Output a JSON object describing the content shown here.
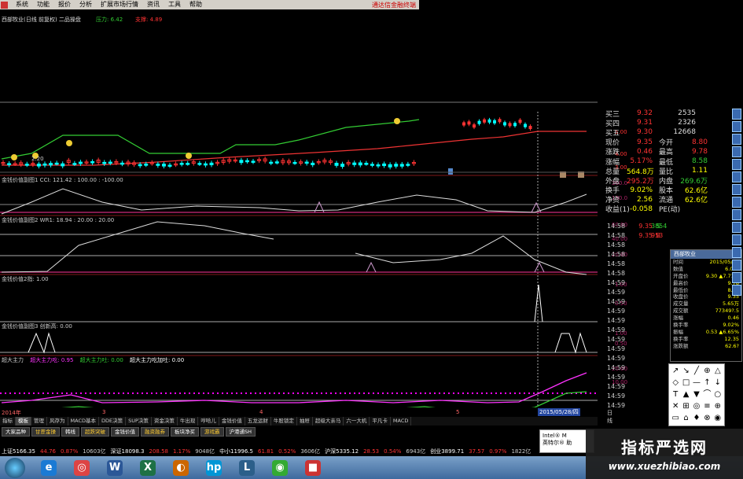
{
  "menu": [
    "系统",
    "功能",
    "报价",
    "分析",
    "扩展市场行情",
    "资讯",
    "工具",
    "帮助"
  ],
  "brand": "通达信金融终端",
  "chart_title": "西部牧业(日线 前复权) 二品操盘",
  "pressure": {
    "label": "压力:",
    "value": "6.42",
    "support_label": "支撑:",
    "support_value": "4.89"
  },
  "main_axis": [
    "5.00",
    "4.00",
    "3.00"
  ],
  "main_low_label": "2.20",
  "panels": [
    {
      "title": "金钱价值副图1 CCI: 121.42 : 100.00 : -100.00",
      "ticks": [
        "300.0",
        "150.0",
        "0.00"
      ]
    },
    {
      "title": "金钱价值副图2 WR1: 18.94 : 20.00 : 20.00",
      "ticks": [
        "60.00",
        "40.00",
        "20.00"
      ]
    },
    {
      "title": "金钱价值2指: 1.00",
      "ticks": [
        "1.00",
        "0.50"
      ]
    },
    {
      "title": "金钱价值副图3 创新高: 0.00",
      "ticks": [
        "1.00",
        "0.50"
      ]
    },
    {
      "title": "超大主力",
      "sub": "超大主力吃: 0.95",
      "sub2": "超大主力吐: 0.00",
      "sub3": "超大主力吃加吐: 0.00",
      "ticks": [
        "20.00",
        "10.00"
      ]
    }
  ],
  "quote": [
    {
      "l": "买三",
      "v": "9.32",
      "s": "2535"
    },
    {
      "l": "买四",
      "v": "9.31",
      "s": "2326"
    },
    {
      "l": "买五",
      "v": "9.30",
      "s": "12668"
    }
  ],
  "quote2": [
    {
      "l": "现价",
      "v": "9.35",
      "l2": "今开",
      "v2": "8.80"
    },
    {
      "l": "涨跌",
      "v": "0.46",
      "l2": "最高",
      "v2": "9.78"
    },
    {
      "l": "涨幅",
      "v": "5.17%",
      "l2": "最低",
      "v2": "8.58"
    },
    {
      "l": "总量",
      "v": "564.8万",
      "l2": "量比",
      "v2": "1.11"
    },
    {
      "l": "外盘",
      "v": "295.2万",
      "l2": "内盘",
      "v2": "269.6万"
    },
    {
      "l": "换手",
      "v": "9.02%",
      "l2": "股本",
      "v2": "62.6亿"
    },
    {
      "l": "净资",
      "v": "2.56",
      "l2": "流通",
      "v2": "62.6亿"
    },
    {
      "l": "收益(1)",
      "v": "-0.058",
      "l2": "PE(动)",
      "v2": ""
    }
  ],
  "ticks": [
    {
      "t": "14:58",
      "p": "9.35",
      "v": "3854",
      "d": "S"
    },
    {
      "t": "14:58",
      "p": "9.35",
      "v": "953",
      "d": "B"
    },
    {
      "t": "14:58",
      "p": "",
      "v": "",
      "d": ""
    },
    {
      "t": "14:58",
      "p": "",
      "v": "",
      "d": ""
    },
    {
      "t": "14:58",
      "p": "",
      "v": "",
      "d": ""
    },
    {
      "t": "14:58",
      "p": "",
      "v": "",
      "d": ""
    },
    {
      "t": "14:59",
      "p": "",
      "v": "",
      "d": ""
    },
    {
      "t": "14:59",
      "p": "",
      "v": "",
      "d": ""
    },
    {
      "t": "14:59",
      "p": "",
      "v": "",
      "d": ""
    },
    {
      "t": "14:59",
      "p": "",
      "v": "",
      "d": ""
    },
    {
      "t": "14:59",
      "p": "",
      "v": "",
      "d": ""
    },
    {
      "t": "14:59",
      "p": "",
      "v": "",
      "d": ""
    },
    {
      "t": "14:59",
      "p": "",
      "v": "",
      "d": ""
    },
    {
      "t": "14:59",
      "p": "",
      "v": "",
      "d": ""
    },
    {
      "t": "14:59",
      "p": "",
      "v": "",
      "d": ""
    },
    {
      "t": "14:59",
      "p": "",
      "v": "",
      "d": ""
    },
    {
      "t": "14:59",
      "p": "",
      "v": "",
      "d": ""
    },
    {
      "t": "14:59",
      "p": "",
      "v": "",
      "d": ""
    },
    {
      "t": "14:59",
      "p": "",
      "v": "",
      "d": ""
    },
    {
      "t": "14:59",
      "p": "",
      "v": "",
      "d": ""
    }
  ],
  "popup": {
    "title": "西部牧业",
    "rows": [
      [
        "时间",
        "2015/05/28"
      ],
      [
        "数值",
        "6.02?"
      ],
      [
        "开盘价",
        "9.30 ▲7.71%"
      ],
      [
        "最高价",
        "9.78"
      ],
      [
        "最低价",
        "8.58"
      ],
      [
        "收盘价",
        "9.35"
      ],
      [
        "成交量",
        "5.65万"
      ],
      [
        "成交额",
        "77349?.5"
      ],
      [
        "涨幅",
        "0.46"
      ],
      [
        "换手率",
        "9.02%"
      ],
      [
        "振幅",
        "0.53 ▲6.65%"
      ],
      [
        "换手率",
        "12.35"
      ],
      [
        "涨跌额",
        "62.6?"
      ]
    ]
  },
  "toolbox": [
    "↗",
    "↘",
    "╱",
    "⊕",
    "△",
    "◇",
    "□",
    "—",
    "↑",
    "↓",
    "T",
    "▲",
    "▼",
    "⌒",
    "○",
    "✕",
    "⊞",
    "◎",
    "≡",
    "⊕",
    "▭",
    "⌂",
    "♦",
    "⊗",
    "◉"
  ],
  "dates": {
    "left": "2014年",
    "m1": "3",
    "m2": "4",
    "m3": "5",
    "sel": "2015/05/28/四",
    "day": "日线"
  },
  "tabs1": [
    "指标",
    "模板",
    "管理",
    "风存为",
    "MACD基本",
    "DDE决策",
    "SUP决策",
    "资金决策",
    "牛出现",
    "哼哈儿",
    "金钱价值",
    "五龙运财",
    "牛股锁定",
    "抽屉",
    "超级大亲马",
    "六一大机",
    "平凡卡",
    "MACD"
  ],
  "tabs2": [
    "大家品种",
    "甘蔗金操",
    "韩线",
    "超跌突破",
    "金钱价值",
    "融资融券",
    "板块净买",
    "游戏霸",
    "沪港通SH"
  ],
  "status": [
    {
      "t": "上证5166.35",
      "c": "#fff"
    },
    {
      "t": "44.76",
      "c": "#f33"
    },
    {
      "t": "0.87%",
      "c": "#f33"
    },
    {
      "t": "10603亿",
      "c": "#ccc"
    },
    {
      "t": "深证18098.3",
      "c": "#fff"
    },
    {
      "t": "208.58",
      "c": "#f33"
    },
    {
      "t": "1.17%",
      "c": "#f33"
    },
    {
      "t": "9048亿",
      "c": "#ccc"
    },
    {
      "t": "中小11996.5",
      "c": "#fff"
    },
    {
      "t": "61.81",
      "c": "#f33"
    },
    {
      "t": "0.52%",
      "c": "#f33"
    },
    {
      "t": "3606亿",
      "c": "#ccc"
    },
    {
      "t": "沪深5335.12",
      "c": "#fff"
    },
    {
      "t": "28.53",
      "c": "#f33"
    },
    {
      "t": "0.54%",
      "c": "#f33"
    },
    {
      "t": "6943亿",
      "c": "#ccc"
    },
    {
      "t": "创业3899.71",
      "c": "#fff"
    },
    {
      "t": "37.57",
      "c": "#f33"
    },
    {
      "t": "0.97%",
      "c": "#f33"
    },
    {
      "t": "1822亿",
      "c": "#ccc"
    }
  ],
  "balloon": {
    "l1": "Intel® M",
    "l2": "英特尔® 助"
  },
  "watermark": {
    "line1": "指标严选网",
    "line2": "www.xuezhibiao.com"
  },
  "taskbar_apps": [
    {
      "g": "e",
      "c": "#1a7ad4"
    },
    {
      "g": "◎",
      "c": "#d44"
    },
    {
      "g": "W",
      "c": "#2b5797"
    },
    {
      "g": "X",
      "c": "#1e7145"
    },
    {
      "g": "◐",
      "c": "#c60"
    },
    {
      "g": "hp",
      "c": "#0096d6"
    },
    {
      "g": "L",
      "c": "#2c5f8a"
    },
    {
      "g": "◉",
      "c": "#3a3"
    },
    {
      "g": "■",
      "c": "#c33"
    }
  ],
  "colors": {
    "up": "#ff3333",
    "down": "#00ffff",
    "green": "#33cc33",
    "yellow": "#ffff00",
    "bg": "#000000",
    "panel_line": "#aa2266"
  }
}
